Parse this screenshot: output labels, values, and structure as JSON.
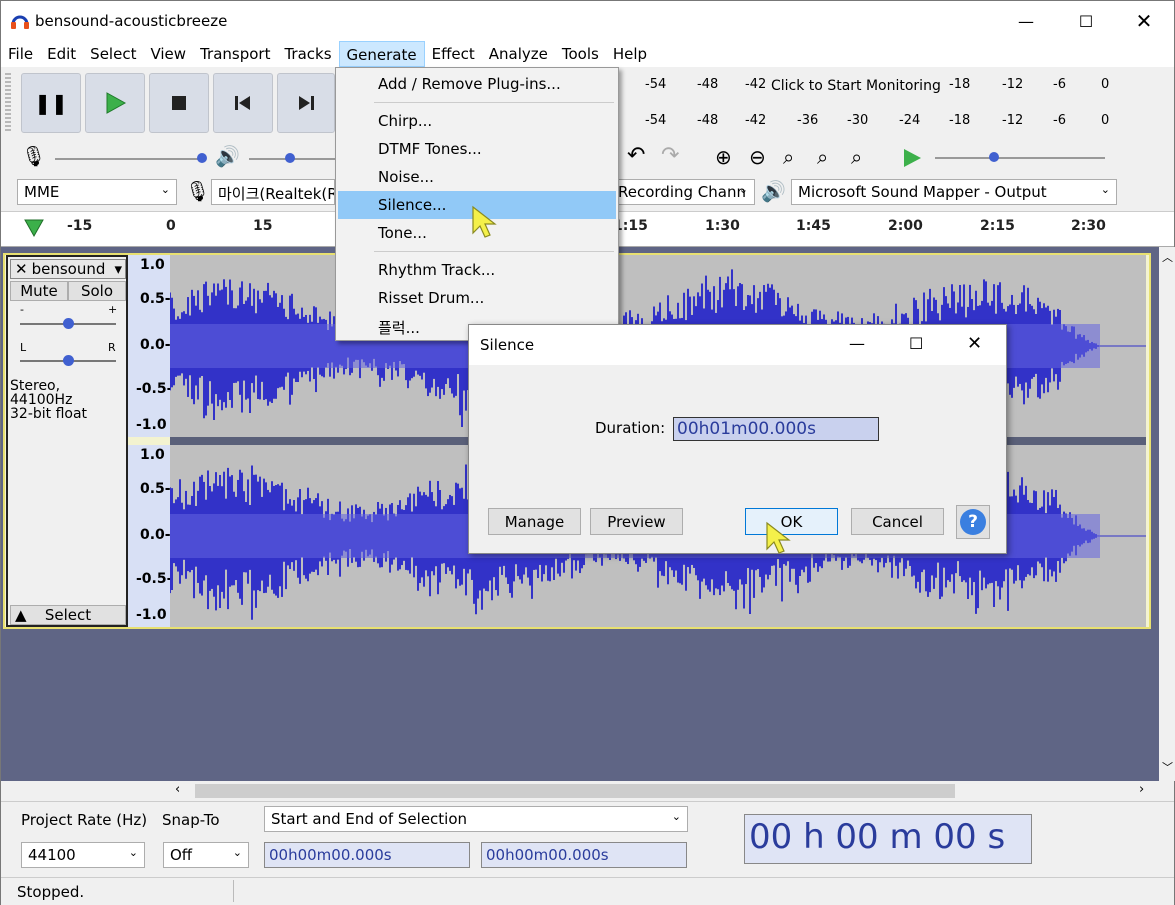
{
  "window": {
    "title": "bensound-acousticbreeze"
  },
  "menubar": [
    "File",
    "Edit",
    "Select",
    "View",
    "Transport",
    "Tracks",
    "Generate",
    "Effect",
    "Analyze",
    "Tools",
    "Help"
  ],
  "meter": {
    "rec_ticks": [
      "-54",
      "-48",
      "-42"
    ],
    "monitor_text": "Click to Start Monitoring",
    "rec_ticks2": [
      "-18",
      "-12",
      "-6",
      "0"
    ],
    "play_ticks": [
      "-54",
      "-48",
      "-42",
      "-36",
      "-30",
      "-24",
      "-18",
      "-12",
      "-6",
      "0"
    ]
  },
  "devices": {
    "host": "MME",
    "mic": "마이크(Realtek(R)",
    "rec_channels": "Recording Chann",
    "output": "Microsoft Sound Mapper - Output"
  },
  "ruler": [
    "-15",
    "0",
    "15",
    "1:15",
    "1:30",
    "1:45",
    "2:00",
    "2:15",
    "2:30"
  ],
  "track": {
    "name": "bensound",
    "mute": "Mute",
    "solo": "Solo",
    "gain_minus": "-",
    "gain_plus": "+",
    "pan_l": "L",
    "pan_r": "R",
    "info1": "Stereo, 44100Hz",
    "info2": "32-bit float",
    "select": "Select",
    "scale": [
      "1.0",
      "0.5-",
      "0.0-",
      "-0.5-",
      "-1.0"
    ]
  },
  "generate_menu": {
    "items": [
      "Add / Remove Plug-ins...",
      "Chirp...",
      "DTMF Tones...",
      "Noise...",
      "Silence...",
      "Tone...",
      "Rhythm Track...",
      "Risset Drum...",
      "플럭..."
    ],
    "highlighted": "Silence..."
  },
  "dialog": {
    "title": "Silence",
    "duration_label": "Duration:",
    "duration_value": "00h01m00.000s",
    "buttons": {
      "manage": "Manage",
      "preview": "Preview",
      "ok": "OK",
      "cancel": "Cancel",
      "help": "?"
    }
  },
  "selection_toolbar": {
    "project_rate_label": "Project Rate (Hz)",
    "snap_label": "Snap-To",
    "mode": "Start and End of Selection",
    "rate": "44100",
    "snap": "Off",
    "start": "00h00m00.000s",
    "end": "00h00m00.000s",
    "audio_position": "00 h 00 m 00 s"
  },
  "status": "Stopped.",
  "colors": {
    "accent": "#91c9f7",
    "wave": "#3232c8",
    "background": "#5f6585"
  }
}
